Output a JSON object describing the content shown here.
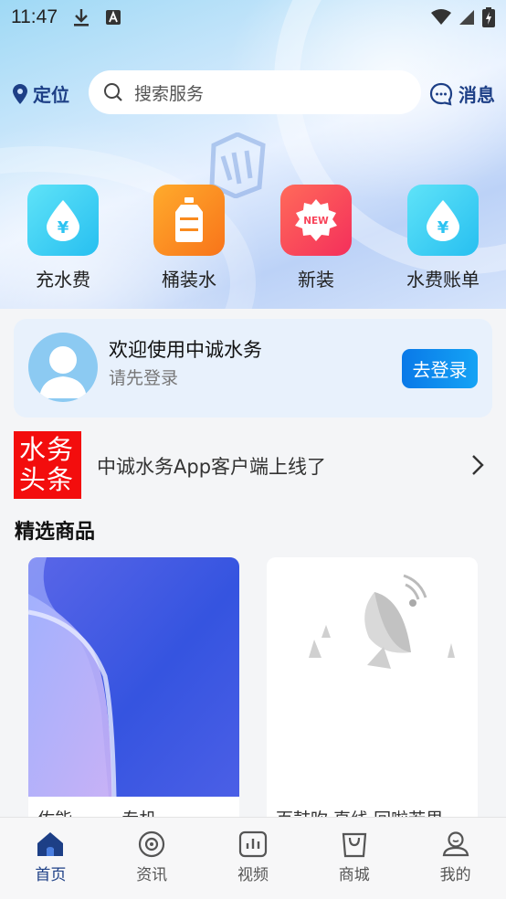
{
  "status_bar": {
    "time": "11:47"
  },
  "header": {
    "location_label": "定位",
    "search_placeholder": "搜索服务",
    "message_label": "消息"
  },
  "quick_actions": [
    {
      "label": "充水费",
      "icon": "water-drop-yen-icon"
    },
    {
      "label": "桶装水",
      "icon": "water-bottle-icon"
    },
    {
      "label": "新装",
      "icon": "new-badge-icon"
    },
    {
      "label": "水费账单",
      "icon": "water-drop-yen-icon"
    }
  ],
  "welcome": {
    "title": "欢迎使用中诚水务",
    "subtitle": "请先登录",
    "login_button": "去登录"
  },
  "news": {
    "logo_line1": "水务",
    "logo_line2": "头条",
    "headline": "中诚水务App客户端上线了"
  },
  "section": {
    "title": "精选商品"
  },
  "products": [
    {
      "title": "佐能 ... ... 专机"
    },
    {
      "title": "百鼓吹 直线 回啦若里"
    }
  ],
  "tabbar": [
    {
      "label": "首页",
      "icon": "home-icon",
      "active": true
    },
    {
      "label": "资讯",
      "icon": "news-icon",
      "active": false
    },
    {
      "label": "视频",
      "icon": "video-icon",
      "active": false
    },
    {
      "label": "商城",
      "icon": "shop-bag-icon",
      "active": false
    },
    {
      "label": "我的",
      "icon": "profile-icon",
      "active": false
    }
  ],
  "colors": {
    "accent": "#1d3f86",
    "cyan_icon": "#3fd0f3",
    "orange_icon": "#f98a1e",
    "red_icon": "#f8445a",
    "login_button": "#0a79e8",
    "news_logo_bg": "#f30d0d"
  }
}
